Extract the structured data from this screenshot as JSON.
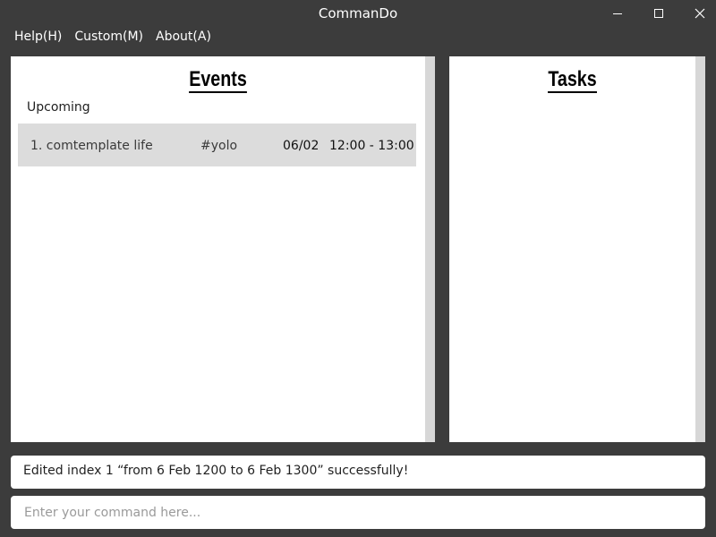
{
  "window": {
    "title": "CommanDo",
    "controls": {
      "minimize_icon": "minimize-icon",
      "maximize_icon": "maximize-icon",
      "close_icon": "close-icon"
    }
  },
  "menu": {
    "items": [
      {
        "label": "Help(H)"
      },
      {
        "label": "Custom(M)"
      },
      {
        "label": "About(A)"
      }
    ]
  },
  "events_panel": {
    "heading": "Events",
    "section_label": "Upcoming",
    "items": [
      {
        "title": "1. comtemplate life",
        "tag": "#yolo",
        "date": "06/02",
        "time": "12:00 - 13:00"
      }
    ]
  },
  "tasks_panel": {
    "heading": "Tasks",
    "items": []
  },
  "feedback": {
    "message": "Edited index 1 “from 6 Feb 1200 to 6 Feb 1300” successfully!"
  },
  "command": {
    "value": "",
    "placeholder": "Enter your command here..."
  },
  "colors": {
    "window_bg": "#3c3c3c",
    "panel_bg": "#ffffff",
    "row_highlight": "#dcdcdc",
    "scrollbar": "#d7d7d7"
  }
}
